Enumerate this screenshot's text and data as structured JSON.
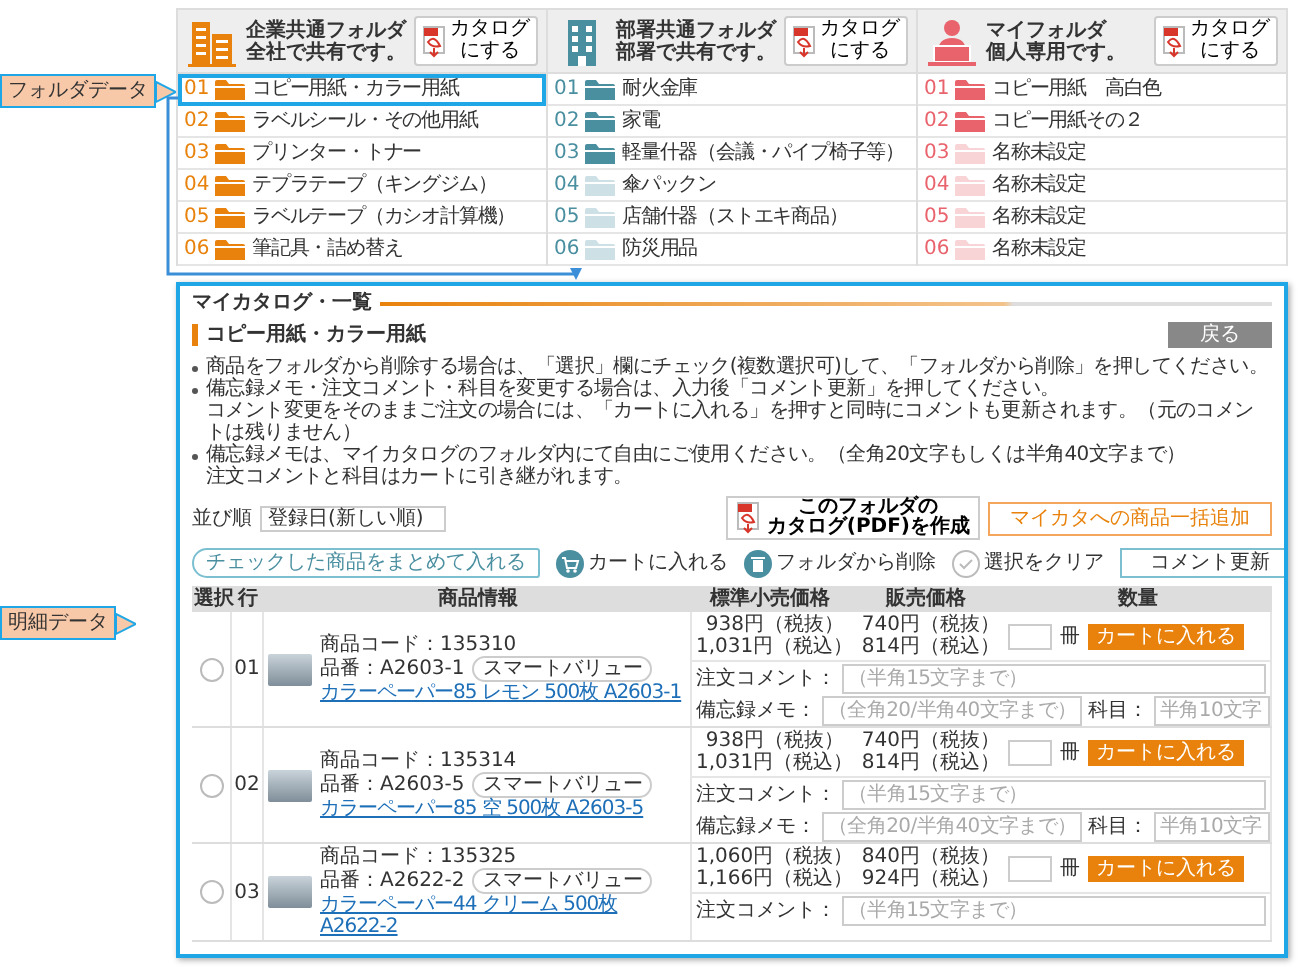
{
  "callouts": [
    {
      "text": "フォルダデータ"
    },
    {
      "text": "明細データ"
    }
  ],
  "folder_groups": [
    {
      "kind": "company",
      "title": "企業共通フォルダ",
      "subtitle": "全社で共有です。",
      "color": "#e8820c",
      "catalog_button": [
        "カタログ",
        "にする"
      ],
      "folders": [
        {
          "number": "01",
          "name": "コピー用紙・カラー用紙",
          "filled": true,
          "selected": true
        },
        {
          "number": "02",
          "name": "ラベルシール・その他用紙",
          "filled": true,
          "selected": false
        },
        {
          "number": "03",
          "name": "プリンター・トナー",
          "filled": true,
          "selected": false
        },
        {
          "number": "04",
          "name": "テプラテープ（キングジム）",
          "filled": true,
          "selected": false
        },
        {
          "number": "05",
          "name": "ラベルテープ（カシオ計算機）",
          "filled": true,
          "selected": false
        },
        {
          "number": "06",
          "name": "筆記具・詰め替え",
          "filled": true,
          "selected": false
        }
      ]
    },
    {
      "kind": "department",
      "title": "部署共通フォルダ",
      "subtitle": "部署で共有です。",
      "color": "#4a8fa0",
      "catalog_button": [
        "カタログ",
        "にする"
      ],
      "folders": [
        {
          "number": "01",
          "name": "耐火金庫",
          "filled": true,
          "selected": false
        },
        {
          "number": "02",
          "name": "家電",
          "filled": true,
          "selected": false
        },
        {
          "number": "03",
          "name": "軽量什器（会議・パイプ椅子等）",
          "filled": true,
          "selected": false
        },
        {
          "number": "04",
          "name": "傘パックン",
          "filled": false,
          "selected": false
        },
        {
          "number": "05",
          "name": "店舗什器（ストエキ商品）",
          "filled": false,
          "selected": false
        },
        {
          "number": "06",
          "name": "防災用品",
          "filled": false,
          "selected": false
        }
      ]
    },
    {
      "kind": "personal",
      "title": "マイフォルダ",
      "subtitle": "個人専用です。",
      "color": "#e9636d",
      "catalog_button": [
        "カタログ",
        "にする"
      ],
      "folders": [
        {
          "number": "01",
          "name": "コピー用紙　高白色",
          "filled": true,
          "selected": false
        },
        {
          "number": "02",
          "name": "コピー用紙その２",
          "filled": true,
          "selected": false
        },
        {
          "number": "03",
          "name": "名称未設定",
          "filled": false,
          "selected": false
        },
        {
          "number": "04",
          "name": "名称未設定",
          "filled": false,
          "selected": false
        },
        {
          "number": "05",
          "name": "名称未設定",
          "filled": false,
          "selected": false
        },
        {
          "number": "06",
          "name": "名称未設定",
          "filled": false,
          "selected": false
        }
      ]
    }
  ],
  "catalog_panel": {
    "title": "マイカタログ・一覧",
    "folder_name": "コピー用紙・カラー用紙",
    "back_button": "戻る",
    "notes": [
      [
        "商品をフォルダから削除する場合は、「選択」欄にチェック(複数選択可)して、「フォルダから削除」を押してください。"
      ],
      [
        "備忘録メモ・注文コメント・科目を変更する場合は、入力後「コメント更新」を押してください。",
        "コメント変更をそのままご注文の場合には、「カートに入れる」を押すと同時にコメントも更新されます。（元のコメントは残りません）"
      ],
      [
        "備忘録メモは、マイカタログのフォルダ内にて自由にご使用ください。（全角20文字もしくは半角40文字まで）",
        "注文コメントと科目はカートに引き継がれます。"
      ]
    ],
    "sort": {
      "label": "並び順",
      "value": "登録日(新しい順)"
    },
    "pdf_button": [
      "このフォルダの",
      "カタログ(PDF)を作成"
    ],
    "bulk_add_button": "マイカタへの商品一括追加",
    "bulk_label": "チェックした商品をまとめて入れる",
    "actions": [
      {
        "kind": "cart",
        "label": "カートに入れる"
      },
      {
        "kind": "trash",
        "label": "フォルダから削除"
      },
      {
        "kind": "clear",
        "label": "選択をクリア"
      }
    ],
    "update_button": "コメント更新",
    "table": {
      "columns": [
        "選択",
        "行",
        "商品情報",
        "標準小売価格",
        "販売価格",
        "数量"
      ],
      "rows": [
        {
          "checked": false,
          "line": "01",
          "code": "商品コード：135310",
          "part": "品番：A2603-1",
          "tag": "スマートバリュー",
          "link": "カラーペーパー85 レモン 500枚 A2603-1",
          "list_price": [
            "938円（税抜）",
            "1,031円（税込）"
          ],
          "sale_price": [
            "740円（税抜）",
            "814円（税込）"
          ],
          "unit": "冊",
          "cart_button": "カートに入れる",
          "comment": {
            "label": "注文コメント：",
            "placeholder": "（半角15文字まで）"
          },
          "memo": {
            "label": "備忘録メモ：",
            "placeholder": "（全角20/半角40文字まで）",
            "subject_label": "科目：",
            "subject_placeholder": "半角10文字"
          }
        },
        {
          "checked": false,
          "line": "02",
          "code": "商品コード：135314",
          "part": "品番：A2603-5",
          "tag": "スマートバリュー",
          "link": "カラーペーパー85 空 500枚 A2603-5",
          "list_price": [
            "938円（税抜）",
            "1,031円（税込）"
          ],
          "sale_price": [
            "740円（税抜）",
            "814円（税込）"
          ],
          "unit": "冊",
          "cart_button": "カートに入れる",
          "comment": {
            "label": "注文コメント：",
            "placeholder": "（半角15文字まで）"
          },
          "memo": {
            "label": "備忘録メモ：",
            "placeholder": "（全角20/半角40文字まで）",
            "subject_label": "科目：",
            "subject_placeholder": "半角10文字"
          }
        },
        {
          "checked": false,
          "line": "03",
          "code": "商品コード：135325",
          "part": "品番：A2622-2",
          "tag": "スマートバリュー",
          "link": "カラーペーパー44 クリーム 500枚 A2622-2",
          "list_price": [
            "1,060円（税抜）",
            "1,166円（税込）"
          ],
          "sale_price": [
            "840円（税抜）",
            "924円（税込）"
          ],
          "unit": "冊",
          "cart_button": "カートに入れる",
          "comment": {
            "label": "注文コメント：",
            "placeholder": "（半角15文字まで）"
          }
        }
      ]
    }
  }
}
